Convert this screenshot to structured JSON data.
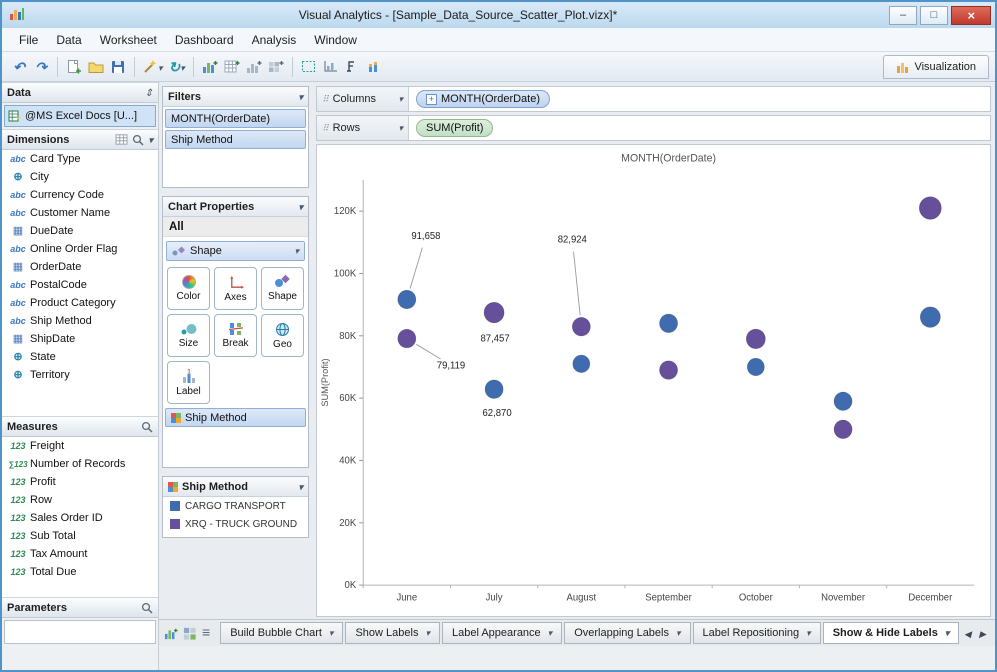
{
  "window": {
    "title": "Visual Analytics - [Sample_Data_Source_Scatter_Plot.vizx]*"
  },
  "menu": {
    "items": [
      "File",
      "Data",
      "Worksheet",
      "Dashboard",
      "Analysis",
      "Window"
    ]
  },
  "toolbar": {
    "visualization": "Visualization"
  },
  "data_panel": {
    "header": "Data",
    "source": "@MS Excel Docs [U...]",
    "dimensions": {
      "header": "Dimensions",
      "items": [
        {
          "icon": "abc",
          "label": "Card Type"
        },
        {
          "icon": "geo",
          "label": "City"
        },
        {
          "icon": "abc",
          "label": "Currency Code"
        },
        {
          "icon": "abc",
          "label": "Customer Name"
        },
        {
          "icon": "date",
          "label": "DueDate"
        },
        {
          "icon": "abc",
          "label": "Online Order Flag"
        },
        {
          "icon": "date",
          "label": "OrderDate"
        },
        {
          "icon": "abc",
          "label": "PostalCode"
        },
        {
          "icon": "abc",
          "label": "Product Category"
        },
        {
          "icon": "abc",
          "label": "Ship Method"
        },
        {
          "icon": "date",
          "label": "ShipDate"
        },
        {
          "icon": "geo",
          "label": "State"
        },
        {
          "icon": "geo",
          "label": "Territory"
        }
      ]
    },
    "measures": {
      "header": "Measures",
      "items": [
        {
          "icon": "num",
          "label": "Freight"
        },
        {
          "icon": "sum",
          "label": "Number of Records"
        },
        {
          "icon": "num",
          "label": "Profit"
        },
        {
          "icon": "num",
          "label": "Row"
        },
        {
          "icon": "num",
          "label": "Sales Order ID"
        },
        {
          "icon": "num",
          "label": "Sub Total"
        },
        {
          "icon": "num",
          "label": "Tax Amount"
        },
        {
          "icon": "num",
          "label": "Total Due"
        }
      ]
    },
    "parameters": {
      "header": "Parameters"
    }
  },
  "filters_panel": {
    "header": "Filters",
    "items": [
      "MONTH(OrderDate)",
      "Ship Method"
    ]
  },
  "chart_properties": {
    "header": "Chart Properties",
    "scope": "All",
    "dropdown": "Shape",
    "buttons": [
      "Color",
      "Axes",
      "Shape",
      "Size",
      "Break",
      "Geo",
      "Label"
    ],
    "shelf_pill": "Ship Method"
  },
  "legend": {
    "header": "Ship Method",
    "items": [
      {
        "color": "#3e6cae",
        "label": "CARGO TRANSPORT"
      },
      {
        "color": "#66509b",
        "label": "XRQ - TRUCK GROUND"
      }
    ]
  },
  "shelves": {
    "columns_label": "Columns",
    "columns_pill": "MONTH(OrderDate)",
    "rows_label": "Rows",
    "rows_pill": "SUM(Profit)"
  },
  "chart_data": {
    "type": "scatter",
    "title": "MONTH(OrderDate)",
    "ylabel": "SUM(Profit)",
    "categories": [
      "June",
      "July",
      "August",
      "September",
      "October",
      "November",
      "December"
    ],
    "ylim": [
      0,
      130000
    ],
    "yticks": [
      0,
      20000,
      40000,
      60000,
      80000,
      100000,
      120000
    ],
    "ytick_labels": [
      "0K",
      "20K",
      "40K",
      "60K",
      "80K",
      "100K",
      "120K"
    ],
    "legend_position": "left-panel",
    "grid": false,
    "series": [
      {
        "name": "CARGO TRANSPORT",
        "color": "#3e6cae",
        "values": [
          91658,
          62870,
          71000,
          84000,
          70000,
          59000,
          86000
        ],
        "sizes": [
          9,
          9,
          8.5,
          9,
          8.5,
          9,
          10
        ]
      },
      {
        "name": "XRQ - TRUCK GROUND",
        "color": "#66509b",
        "values": [
          79119,
          87457,
          82924,
          69000,
          79000,
          50000,
          121000
        ],
        "sizes": [
          9,
          10,
          9,
          9,
          9.5,
          9,
          11
        ]
      }
    ],
    "annotations": [
      {
        "text": "91,658",
        "series": 0,
        "cat": 0,
        "dx": 19,
        "dy": -62,
        "leader": true
      },
      {
        "text": "82,924",
        "series": 1,
        "cat": 2,
        "dx": -9,
        "dy": -85,
        "leader": true
      },
      {
        "text": "87,457",
        "series": 1,
        "cat": 1,
        "dx": 1,
        "dy": 25,
        "leader": false
      },
      {
        "text": "79,119",
        "series": 1,
        "cat": 0,
        "dx": 44,
        "dy": 26,
        "leader": true
      },
      {
        "text": "62,870",
        "series": 0,
        "cat": 1,
        "dx": 3,
        "dy": 23,
        "leader": false
      }
    ]
  },
  "bottom_bar": {
    "tabs": [
      {
        "label": "Build Bubble Chart",
        "active": false
      },
      {
        "label": "Show Labels",
        "active": false
      },
      {
        "label": "Label Appearance",
        "active": false
      },
      {
        "label": "Overlapping Labels",
        "active": false
      },
      {
        "label": "Label Repositioning",
        "active": false
      },
      {
        "label": "Show & Hide Labels",
        "active": true
      }
    ]
  }
}
